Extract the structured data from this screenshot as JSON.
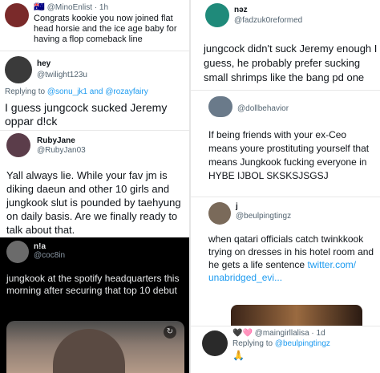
{
  "tweets_left": {
    "t1": {
      "flag": "🇦🇺",
      "handle": "@MinoEnlist · 1h",
      "text": "Congrats kookie you now joined flat head horsie and the ice age baby for having  a flop comeback line"
    },
    "t2": {
      "name": "hey",
      "handle": "@twilight123u",
      "reply_prefix": "Replying to",
      "reply_to": "@sonu_jk1 and @rozayfairy",
      "text": "I guess jungcock sucked Jeremy oppar d!ck"
    },
    "t3": {
      "name": "RubyJane",
      "handle": "@RubyJan03",
      "text": "Yall always lie. While your fav jm is diking daeun and other 10 girls and jungkook slut is pounded by taehyung on daily basis. Are we finally ready to talk about that."
    },
    "t4": {
      "name": "n!a",
      "handle": "@coc8in",
      "text": "jungkook at the spotify headquarters this morning after securing that top 10 debut"
    }
  },
  "tweets_right": {
    "t5": {
      "name": "nəz",
      "handle": "@fadzuk0reformed",
      "text": "jungcock didn't suck Jeremy enough I guess, he probably prefer sucking small shrimps like the bang pd one"
    },
    "t6": {
      "handle": "@dollbehavior",
      "text": "If being friends with your ex-Ceo means youre prostituting yourself that means Jungkook fucking everyone in HYBE IJBOL SKSKSJSGSJ"
    },
    "t7": {
      "name": "j",
      "handle": "@beulpingtingz",
      "text": "when qatari officials catch twinkkook trying on dresses in his hotel room and he gets a life sentence",
      "link": "twitter.com/ unabridged_evi..."
    },
    "t8": {
      "hearts": "🖤🩷",
      "handle": "@maingirllalisa · 1d",
      "reply_prefix": "Replying to",
      "reply_to": "@beulpingtingz",
      "emoji": "🙏"
    }
  }
}
